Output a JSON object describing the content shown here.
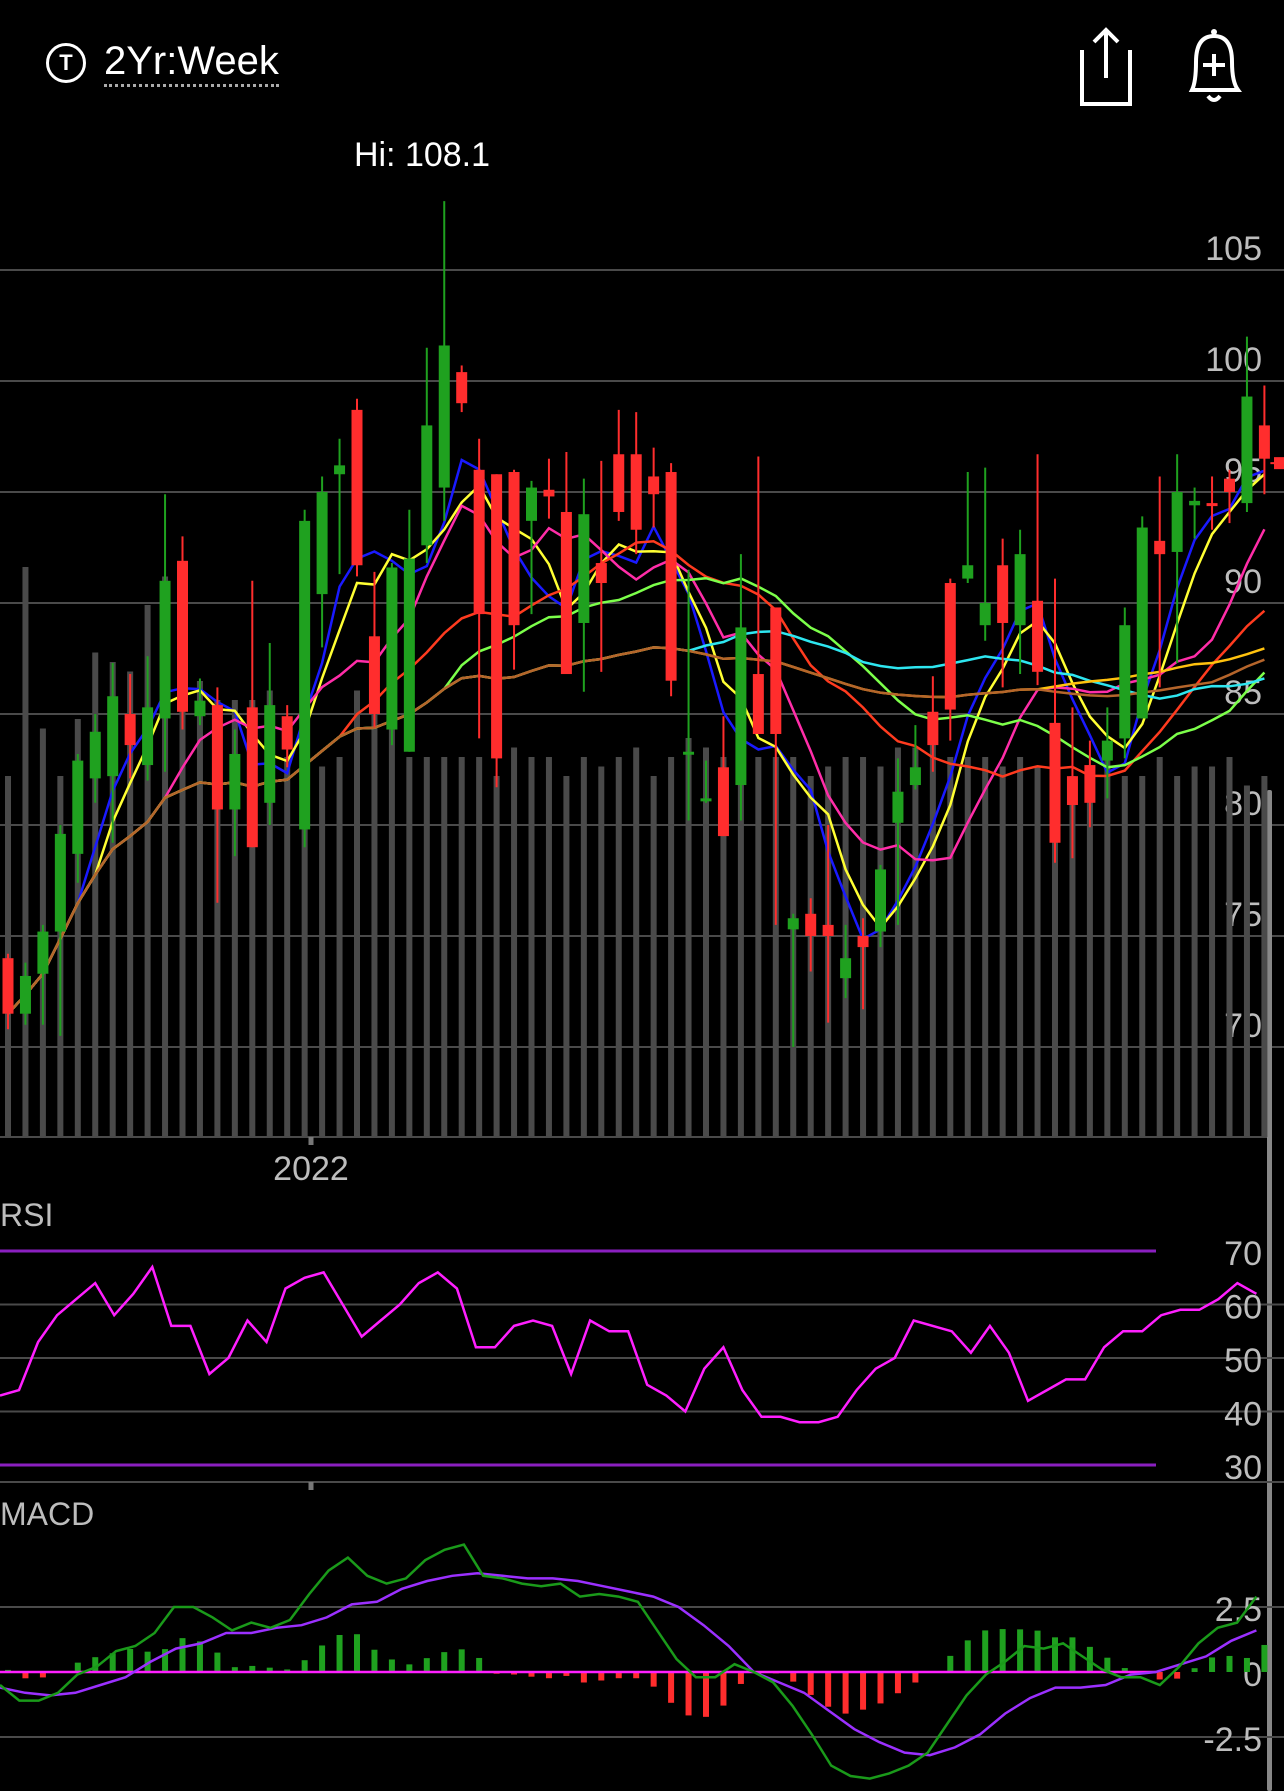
{
  "header": {
    "ticker_icon_letter": "T",
    "period_label": "2Yr:Week",
    "share_icon": "share-icon",
    "alert_icon": "bell-plus-icon"
  },
  "chart_data": [
    {
      "type": "candlestick",
      "title": "",
      "hi_label": "Hi: 108.1",
      "x_tick_labels": [
        "2022"
      ],
      "y_ticks": [
        105,
        100,
        95,
        90,
        85,
        80,
        75,
        70
      ],
      "ylim": [
        66.2,
        106.2
      ],
      "grid": true,
      "last_price_marker": 96.3,
      "candles": [
        [
          74.0,
          71.5,
          70.8,
          74.2
        ],
        [
          71.5,
          73.2,
          71.0,
          73.8
        ],
        [
          73.3,
          75.2,
          71.0,
          75.5
        ],
        [
          75.2,
          79.6,
          70.5,
          80.0
        ],
        [
          78.7,
          82.9,
          77.4,
          83.2
        ],
        [
          82.1,
          84.2,
          81.0,
          85.0
        ],
        [
          82.2,
          85.8,
          79.2,
          87.3
        ],
        [
          85.0,
          83.6,
          82.1,
          86.8
        ],
        [
          82.7,
          85.3,
          82.0,
          87.6
        ],
        [
          84.8,
          91.0,
          82.4,
          94.9
        ],
        [
          91.9,
          85.1,
          84.3,
          93.0
        ],
        [
          84.9,
          85.6,
          84.5,
          86.6
        ],
        [
          85.4,
          80.7,
          76.5,
          86.2
        ],
        [
          80.7,
          83.2,
          78.6,
          84.3
        ],
        [
          85.3,
          79.0,
          81.5,
          91.0
        ],
        [
          81.0,
          85.4,
          80.0,
          88.2
        ],
        [
          84.9,
          83.4,
          82.6,
          85.4
        ],
        [
          79.8,
          93.7,
          79.0,
          94.2
        ],
        [
          90.4,
          95.0,
          88.0,
          95.7
        ],
        [
          95.8,
          96.2,
          91.3,
          97.4
        ],
        [
          98.7,
          91.7,
          91.2,
          99.2
        ],
        [
          88.5,
          85.0,
          84.4,
          91.4
        ],
        [
          84.3,
          91.6,
          83.6,
          91.8
        ],
        [
          83.3,
          92.0,
          83.8,
          94.2
        ],
        [
          92.6,
          98.0,
          91.8,
          101.5
        ],
        [
          95.2,
          101.6,
          93.7,
          108.1
        ],
        [
          100.4,
          99.0,
          98.6,
          100.7
        ],
        [
          96.0,
          89.5,
          83.9,
          97.4
        ],
        [
          95.8,
          83.0,
          81.7,
          94.0
        ],
        [
          95.9,
          89.0,
          87.0,
          96.0
        ],
        [
          93.7,
          95.2,
          89.5,
          95.5
        ],
        [
          95.1,
          94.8,
          93.8,
          96.5
        ],
        [
          94.1,
          86.8,
          88.6,
          96.8
        ],
        [
          89.1,
          94.0,
          86.0,
          95.6
        ],
        [
          91.8,
          90.9,
          86.9,
          96.4
        ],
        [
          96.7,
          94.1,
          93.7,
          98.7
        ],
        [
          96.7,
          93.3,
          92.2,
          98.6
        ],
        [
          95.7,
          94.9,
          93.4,
          97.0
        ],
        [
          95.9,
          86.5,
          85.8,
          96.3
        ],
        [
          83.3,
          83.3,
          80.2,
          91.5
        ],
        [
          81.2,
          81.2,
          81.0,
          82.9
        ],
        [
          82.6,
          79.5,
          80.7,
          84.9
        ],
        [
          81.8,
          88.9,
          80.2,
          92.2
        ],
        [
          86.8,
          84.1,
          84.5,
          96.6
        ],
        [
          89.8,
          84.1,
          75.5,
          87.3
        ],
        [
          75.3,
          75.8,
          70.0,
          76.0
        ],
        [
          76.0,
          75.0,
          73.4,
          76.7
        ],
        [
          75.5,
          75.0,
          71.1,
          80.0
        ],
        [
          73.1,
          74.0,
          72.2,
          75.5
        ],
        [
          75.0,
          74.5,
          71.7,
          75.8
        ],
        [
          75.2,
          78.0,
          74.5,
          78.2
        ],
        [
          80.1,
          81.5,
          75.5,
          83.0
        ],
        [
          81.8,
          82.6,
          81.6,
          84.5
        ],
        [
          85.1,
          83.6,
          82.4,
          86.7
        ],
        [
          90.9,
          85.2,
          83.8,
          91.1
        ],
        [
          91.1,
          91.7,
          90.9,
          95.9
        ],
        [
          89.0,
          90.0,
          88.3,
          96.1
        ],
        [
          91.7,
          89.1,
          86.2,
          92.9
        ],
        [
          89.0,
          92.2,
          86.8,
          93.3
        ],
        [
          90.1,
          86.9,
          86.3,
          96.7
        ],
        [
          84.6,
          79.2,
          78.3,
          91.1
        ],
        [
          82.2,
          80.9,
          78.5,
          85.3
        ],
        [
          82.7,
          81.0,
          79.9,
          83.8
        ],
        [
          82.9,
          83.8,
          81.2,
          85.3
        ],
        [
          83.9,
          89.0,
          83.0,
          89.8
        ],
        [
          84.8,
          93.4,
          85.2,
          93.9
        ],
        [
          92.8,
          92.2,
          86.2,
          95.7
        ],
        [
          92.3,
          95.0,
          87.3,
          96.7
        ],
        [
          94.4,
          94.6,
          92.9,
          95.2
        ],
        [
          94.5,
          94.4,
          93.3,
          95.7
        ],
        [
          95.6,
          95.0,
          93.6,
          96.0
        ],
        [
          94.5,
          99.3,
          94.1,
          102.0
        ],
        [
          98.0,
          96.5,
          94.9,
          99.8
        ]
      ],
      "volume": [
        38,
        60,
        43,
        38,
        44,
        51,
        50,
        49,
        56,
        59,
        60,
        48,
        46,
        46,
        46,
        47,
        40,
        42,
        39,
        40,
        47,
        47,
        46,
        40,
        40,
        40,
        40,
        40,
        38,
        41,
        40,
        40,
        38,
        40,
        39,
        40,
        41,
        38,
        40,
        42,
        41,
        40,
        42,
        40,
        40,
        40,
        38,
        39,
        40,
        40,
        39,
        41,
        41,
        42,
        40,
        40,
        40,
        39,
        40,
        39,
        40,
        38,
        38,
        40,
        38,
        38,
        40,
        38,
        39,
        39,
        40,
        37,
        38
      ],
      "series": []
    },
    {
      "type": "line",
      "title": "RSI",
      "y_ticks": [
        70,
        60,
        50,
        40,
        30
      ],
      "bands": [
        70,
        30
      ],
      "ylim": [
        24,
        76
      ],
      "values": [
        43,
        44,
        53,
        58,
        61,
        64,
        58,
        62,
        67,
        56,
        56,
        47,
        50,
        57,
        53,
        63,
        65,
        66,
        60,
        54,
        57,
        60,
        64,
        66,
        63,
        52,
        52,
        56,
        57,
        56,
        47,
        57,
        55,
        55,
        45,
        43,
        40,
        48,
        52,
        44,
        39,
        39,
        38,
        38,
        39,
        44,
        48,
        50,
        57,
        56,
        55,
        51,
        56,
        51,
        42,
        44,
        46,
        46,
        52,
        55,
        55,
        58,
        59,
        59,
        61,
        64,
        62
      ]
    },
    {
      "type": "line",
      "title": "MACD",
      "y_ticks": [
        2.5,
        0,
        -2.5
      ],
      "ylim": [
        -4.5,
        4.5
      ],
      "series": [
        {
          "name": "",
          "values": [
            -0.5,
            -1.1,
            -1.1,
            -0.8,
            -0.1,
            0.2,
            0.8,
            1.0,
            1.5,
            2.5,
            2.5,
            2.1,
            1.6,
            1.9,
            1.7,
            2.0,
            3.0,
            3.9,
            4.4,
            3.7,
            3.4,
            3.6,
            4.3,
            4.7,
            4.9,
            3.7,
            3.6,
            3.4,
            3.3,
            3.4,
            2.9,
            3.0,
            2.9,
            2.7,
            1.6,
            0.5,
            -0.2,
            -0.2,
            0.3,
            0.0,
            -0.4,
            -1.3,
            -2.4,
            -3.6,
            -4.0,
            -4.1,
            -3.9,
            -3.6,
            -3.1,
            -2.0,
            -0.9,
            -0.1,
            0.4,
            1.0,
            0.9,
            1.1,
            0.6,
            0.1,
            -0.2,
            -0.2,
            -0.5,
            0.2,
            1.1,
            1.7,
            1.9,
            2.9
          ]
        },
        {
          "name": "",
          "values": [
            -0.6,
            -0.8,
            -0.9,
            -0.8,
            -0.5,
            -0.2,
            0.4,
            0.9,
            1.1,
            1.5,
            1.5,
            1.7,
            1.8,
            2.1,
            2.6,
            2.7,
            3.2,
            3.5,
            3.7,
            3.8,
            3.7,
            3.6,
            3.6,
            3.5,
            3.3,
            3.1,
            2.9,
            2.5,
            1.8,
            1.0,
            0.0,
            -0.4,
            -0.8,
            -1.5,
            -2.2,
            -2.7,
            -3.1,
            -3.2,
            -2.9,
            -2.4,
            -1.6,
            -1.0,
            -0.6,
            -0.6,
            -0.5,
            -0.1,
            0.0,
            0.3,
            0.6,
            1.2,
            1.6
          ]
        }
      ]
    }
  ]
}
